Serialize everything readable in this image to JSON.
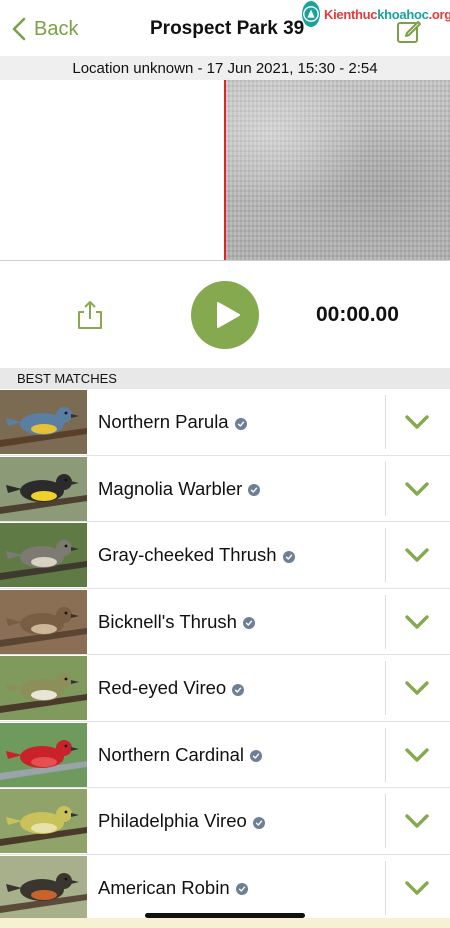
{
  "nav": {
    "back_label": "Back",
    "title": "Prospect Park 39"
  },
  "watermark": {
    "text_a": "Kienthuc",
    "text_b": "khoahoc",
    "text_c": ".org"
  },
  "recording": {
    "info": "Location unknown - 17 Jun 2021, 15:30 - 2:54"
  },
  "player": {
    "time": "00:00.00"
  },
  "matches": {
    "header": "BEST MATCHES",
    "items": [
      {
        "name": "Northern Parula",
        "colors": {
          "bg": "#7a6b52",
          "body": "#5b7fa3",
          "accent": "#e6c23a",
          "branch": "#5a3f2a"
        }
      },
      {
        "name": "Magnolia Warbler",
        "colors": {
          "bg": "#8d9a78",
          "body": "#2b2b2b",
          "accent": "#f0d02a",
          "branch": "#4d4030"
        }
      },
      {
        "name": "Gray-cheeked Thrush",
        "colors": {
          "bg": "#5f7a45",
          "body": "#7d7a72",
          "accent": "#d8d2c4",
          "branch": "#3e3a2e"
        }
      },
      {
        "name": "Bicknell's Thrush",
        "colors": {
          "bg": "#8a6f55",
          "body": "#7a5e44",
          "accent": "#cdb79a",
          "branch": "#5a4532"
        }
      },
      {
        "name": "Red-eyed Vireo",
        "colors": {
          "bg": "#7f9a5c",
          "body": "#8c8f5a",
          "accent": "#e9e6d8",
          "branch": "#4a3a2a"
        }
      },
      {
        "name": "Northern Cardinal",
        "colors": {
          "bg": "#6e9a5e",
          "body": "#c9222a",
          "accent": "#e45050",
          "branch": "#9aa3a8"
        }
      },
      {
        "name": "Philadelphia Vireo",
        "colors": {
          "bg": "#8fa36a",
          "body": "#c9c25a",
          "accent": "#e8e2a8",
          "branch": "#4a3a2a"
        }
      },
      {
        "name": "American Robin",
        "colors": {
          "bg": "#a7b08a",
          "body": "#3b3530",
          "accent": "#c8632e",
          "branch": "#5a4a3a"
        }
      }
    ]
  },
  "theme": {
    "accent": "#84a94f",
    "back_color": "#7aa147",
    "playhead": "#e0242e",
    "verified": "#6c7f96"
  }
}
